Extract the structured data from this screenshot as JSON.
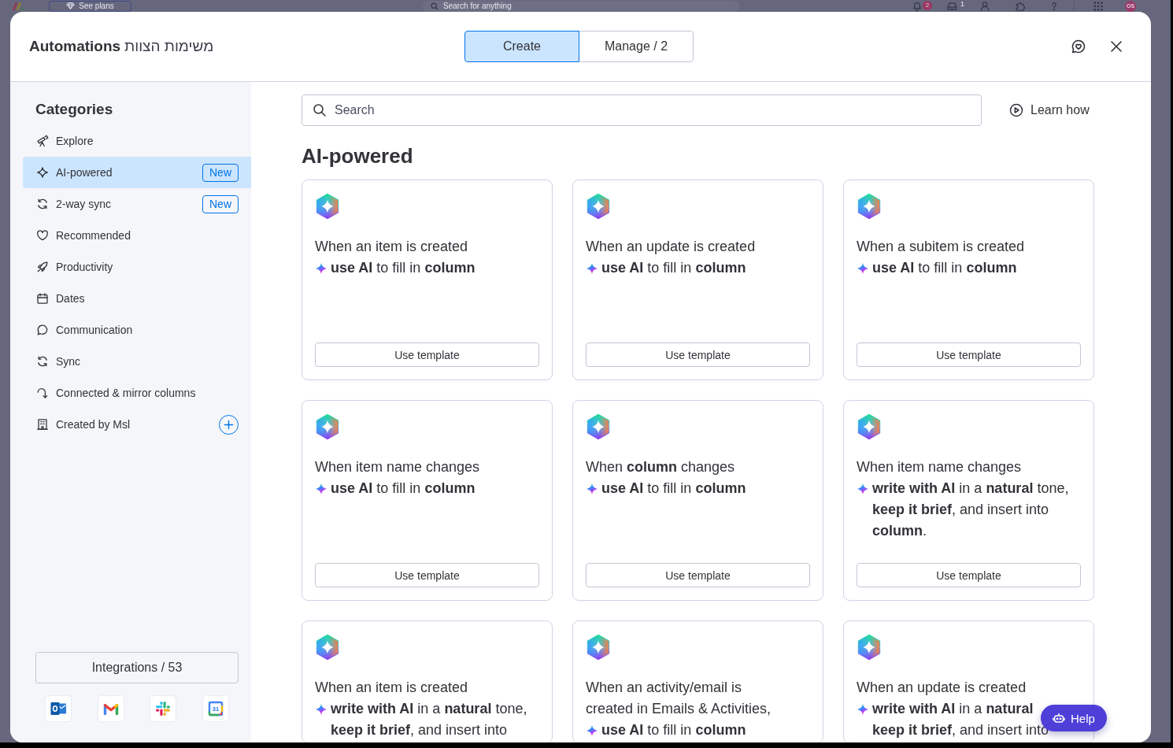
{
  "app_bar": {
    "see_plans": "See plans",
    "search": {
      "placeholder": "Search for anything"
    },
    "notifications_count": "2",
    "inbox_count": "1",
    "avatar_initials": "OS"
  },
  "header": {
    "title": "Automations",
    "board_name": "משימות הצוות",
    "tabs": [
      {
        "label": "Create",
        "selected": true
      },
      {
        "label": "Manage / 2",
        "selected": false
      }
    ]
  },
  "sidebar": {
    "title": "Categories",
    "items": [
      {
        "label": "Explore",
        "kind": "category",
        "selected": false
      },
      {
        "label": "AI-powered",
        "kind": "category",
        "selected": true,
        "badge": "New"
      },
      {
        "label": "2-way sync",
        "kind": "category",
        "selected": false,
        "badge": "New"
      },
      {
        "label": "Recommended",
        "kind": "category",
        "selected": false
      },
      {
        "label": "Productivity",
        "kind": "category",
        "selected": false
      },
      {
        "label": "Dates",
        "kind": "category",
        "selected": false
      },
      {
        "label": "Communication",
        "kind": "category",
        "selected": false
      },
      {
        "label": "Sync",
        "kind": "category",
        "selected": false
      },
      {
        "label": "Connected & mirror columns",
        "kind": "category",
        "selected": false
      },
      {
        "label": "Created by Msl",
        "kind": "custom",
        "selected": false
      }
    ],
    "integrations_button": "Integrations / 53",
    "integrations": [
      {
        "kind": "o-mail"
      },
      {
        "kind": "m-mail"
      },
      {
        "kind": "pinwheel"
      },
      {
        "kind": "calendar",
        "date": "31"
      }
    ]
  },
  "main": {
    "search": {
      "placeholder": "Search"
    },
    "learn_how": "Learn how",
    "section_title": "AI-powered",
    "cards": [
      {
        "trigger": "When an item is created",
        "action": "**use AI** to fill in **column**",
        "button": "Use template"
      },
      {
        "trigger": "When an update is created",
        "action": "**use AI** to fill in **column**",
        "button": "Use template"
      },
      {
        "trigger": "When a subitem is created",
        "action": "**use AI** to fill in **column**",
        "button": "Use template"
      },
      {
        "trigger": "When item name changes",
        "action": "**use AI** to fill in **column**",
        "button": "Use template"
      },
      {
        "trigger": "When **column** changes",
        "action": "**use AI** to fill in **column**",
        "button": "Use template"
      },
      {
        "trigger": "When item name changes",
        "action": "**write with AI** in a **natural** tone,\n**keep it brief**, and insert into\n**column**.",
        "button": "Use template"
      },
      {
        "trigger": "When an item is created",
        "action": "**write with AI** in a **natural** tone,\n**keep it brief**, and insert into"
      },
      {
        "trigger": "When an activity/email is\ncreated in Emails & Activities,",
        "action": "**use AI** to fill in **column**"
      },
      {
        "trigger": "When an update is created",
        "action": "**write with AI** in a **natural**\n**keep it brief**, and insert into"
      }
    ]
  },
  "help_button": "Help"
}
